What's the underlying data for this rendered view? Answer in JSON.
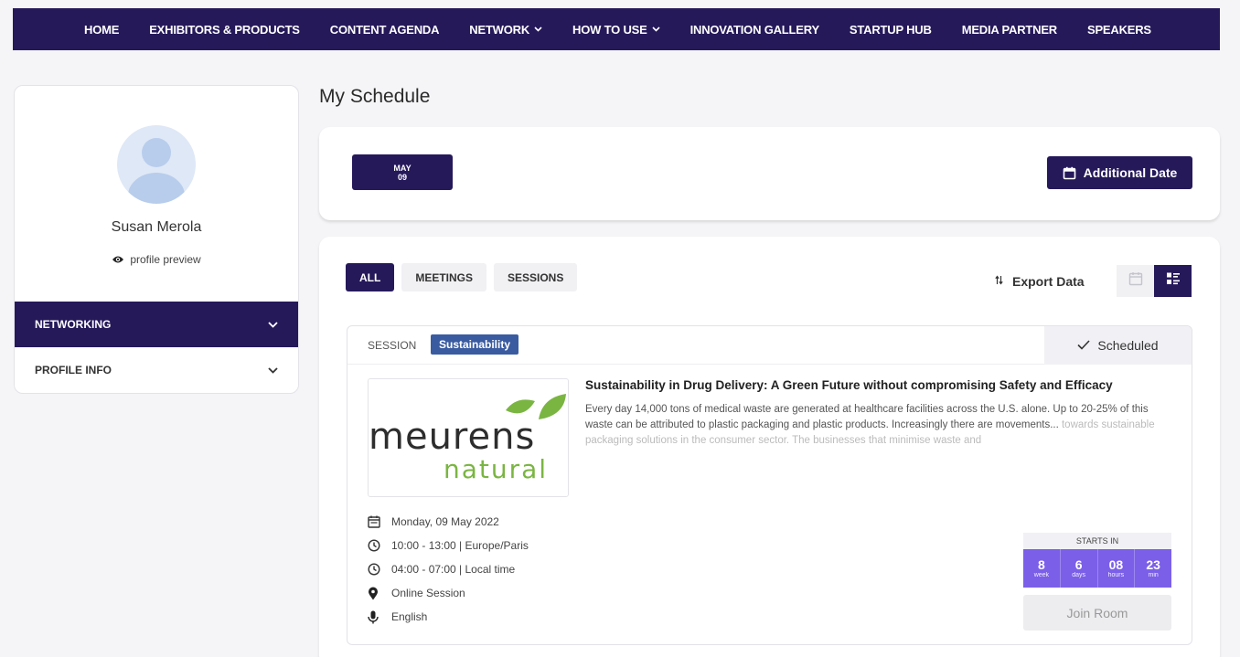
{
  "nav": {
    "items": [
      {
        "label": "HOME",
        "dropdown": false
      },
      {
        "label": "EXHIBITORS & PRODUCTS",
        "dropdown": false
      },
      {
        "label": "CONTENT AGENDA",
        "dropdown": false
      },
      {
        "label": "NETWORK",
        "dropdown": true
      },
      {
        "label": "HOW TO USE",
        "dropdown": true
      },
      {
        "label": "INNOVATION GALLERY",
        "dropdown": false
      },
      {
        "label": "STARTUP HUB",
        "dropdown": false
      },
      {
        "label": "MEDIA PARTNER",
        "dropdown": false
      },
      {
        "label": "SPEAKERS",
        "dropdown": false
      }
    ]
  },
  "sidebar": {
    "user_name": "Susan Merola",
    "profile_preview": "profile preview",
    "items": [
      {
        "label": "NETWORKING",
        "active": true
      },
      {
        "label": "PROFILE INFO",
        "active": false
      }
    ]
  },
  "main": {
    "title": "My Schedule",
    "date_tab": {
      "month": "MAY",
      "day": "09"
    },
    "additional_date": "Additional Date",
    "filters": [
      {
        "label": "ALL",
        "active": true
      },
      {
        "label": "MEETINGS",
        "active": false
      },
      {
        "label": "SESSIONS",
        "active": false
      }
    ],
    "export_label": "Export Data",
    "session": {
      "type_label": "SESSION",
      "tag": "Sustainability",
      "status": "Scheduled",
      "logo_line1": "meurens",
      "logo_line2": "natural",
      "title": "Sustainability in Drug Delivery: A Green Future without compromising Safety and Efficacy",
      "description": "Every day 14,000 tons of medical waste are generated at healthcare facilities across the U.S. alone. Up to 20-25% of this waste can be attributed to plastic packaging and plastic products. Increasingly there are movements...",
      "description_faded": "towards sustainable packaging solutions in the consumer sector. The businesses that minimise waste and",
      "date": "Monday, 09 May 2022",
      "time_event": "10:00 - 13:00 | Europe/Paris",
      "time_local": "04:00 - 07:00 | Local time",
      "location": "Online Session",
      "language": "English",
      "starts_in_label": "STARTS IN",
      "countdown": [
        {
          "value": "8",
          "unit": "week"
        },
        {
          "value": "6",
          "unit": "days"
        },
        {
          "value": "08",
          "unit": "hours"
        },
        {
          "value": "23",
          "unit": "min"
        }
      ],
      "join_label": "Join Room"
    }
  },
  "colors": {
    "brand": "#26195a",
    "tag": "#3a5ba0",
    "countdown": "#7b5fe8",
    "logo_green": "#7ab542"
  }
}
